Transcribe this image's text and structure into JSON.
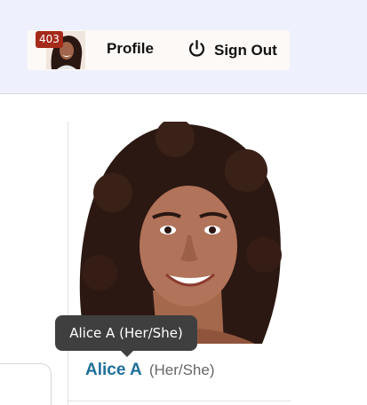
{
  "header": {
    "notification_count": "403",
    "profile_label": "Profile",
    "signout_label": "Sign Out"
  },
  "person": {
    "name": "Alice A",
    "pronouns": "(Her/She)",
    "tooltip": "Alice A (Her/She)"
  },
  "colors": {
    "header_bg": "#eef1fd",
    "badge": "#a52a1a",
    "name_link": "#1f6f99",
    "tooltip_bg": "#3f3f3f"
  },
  "icons": [
    "power-icon"
  ]
}
